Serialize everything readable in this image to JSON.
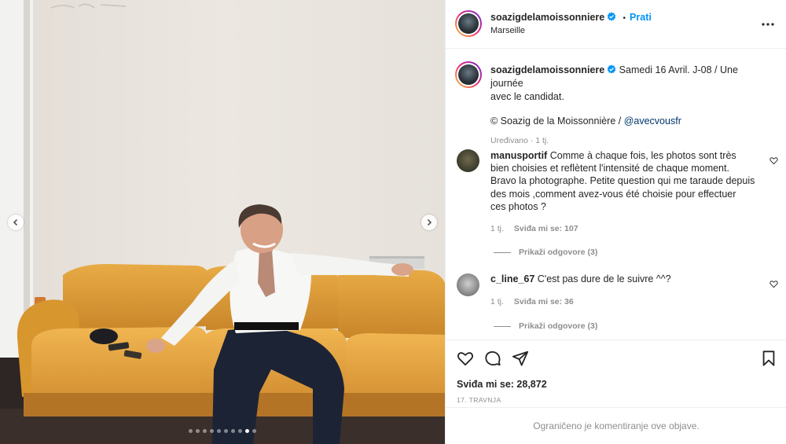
{
  "post": {
    "username": "soazigdelamoissonniere",
    "follow_label": "Prati",
    "separator": "•",
    "location": "Marseille",
    "caption_line1": "Samedi 16 Avril. J-08 / Une journée",
    "caption_line2": "avec le candidat.",
    "credit_prefix": "© Soazig de la Moissonnière / ",
    "credit_mention": "@avecvousfr",
    "caption_meta": "Uređivano · 1 tj."
  },
  "comments": [
    {
      "username": "manusportif",
      "lines": [
        "Comme à chaque fois, les photos sont très",
        "bien choisies et reflètent l'intensité de chaque moment.",
        "Bravo la photographe. Petite question qui me taraude depuis",
        "des mois ,comment avez-vous été choisie pour effectuer",
        "ces photos ?"
      ],
      "time": "1 tj.",
      "likes": "Sviđa mi se: 107",
      "replies": "Prikaži odgovore (3)"
    },
    {
      "username": "c_line_67",
      "lines": [
        "C'est pas dure de le suivre ^^?"
      ],
      "time": "1 tj.",
      "likes": "Sviđa mi se: 36",
      "replies": "Prikaži odgovore (3)"
    }
  ],
  "footer": {
    "likes_total": "Sviđa mi se: 28,872",
    "date": "17. TRAVNJA",
    "restricted_notice": "Ograničeno je komentiranje ove objave."
  },
  "carousel": {
    "total_slides": 10,
    "active_slide": 9
  },
  "icons": {
    "verified": "verified-badge-icon",
    "more": "more-options-icon",
    "like": "heart-icon",
    "comment": "comment-icon",
    "share": "paper-plane-icon",
    "save": "bookmark-icon",
    "prev": "chevron-left-icon",
    "next": "chevron-right-icon"
  },
  "colors": {
    "accent": "#0095f6",
    "verified": "#0095f6",
    "muted": "#8e8e8e",
    "text": "#262626",
    "sofa": "#e0a23c"
  }
}
